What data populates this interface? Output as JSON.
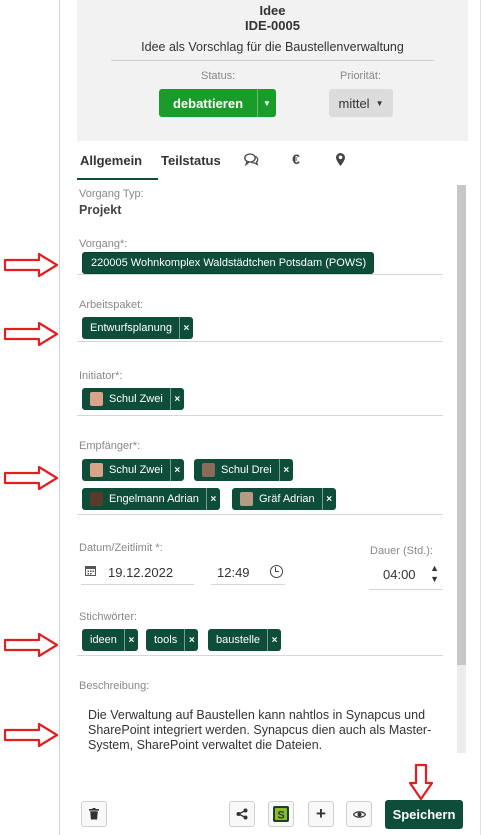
{
  "header": {
    "type": "Idee",
    "id": "IDE-0005",
    "title": "Idee als Vorschlag für die Baustellenverwaltung",
    "status_label": "Status:",
    "status_value": "debattieren",
    "priority_label": "Priorität:",
    "priority_value": "mittel",
    "status_color": "#1a9c2a"
  },
  "tabs": {
    "general": "Allgemein",
    "substatus": "Teilstatus",
    "icons": [
      "comments-icon",
      "euro-icon",
      "map-marker-icon"
    ],
    "euro_glyph": "€"
  },
  "form": {
    "vorgang_typ_label": "Vorgang Typ:",
    "vorgang_typ_value": "Projekt",
    "vorgang_label": "Vorgang*:",
    "vorgang_value": "220005 Wohnkomplex Waldstädtchen Potsdam (POWS)",
    "arbeitspaket_label": "Arbeitspaket:",
    "arbeitspaket_tags": [
      "Entwurfsplanung"
    ],
    "initiator_label": "Initiator*:",
    "initiator_tags": [
      "Schul Zwei"
    ],
    "empfaenger_label": "Empfänger*:",
    "empfaenger_tags": [
      "Schul Zwei",
      "Schul Drei",
      "Engelmann Adrian",
      "Gräf Adrian"
    ],
    "datum_label": "Datum/Zeitlimit *:",
    "datum_value": "19.12.2022",
    "zeit_value": "12:49",
    "dauer_label": "Dauer (Std.):",
    "dauer_value": "04:00",
    "stichwoerter_label": "Stichwörter:",
    "stichwoerter_tags": [
      "ideen",
      "tools",
      "baustelle"
    ],
    "beschreibung_label": "Beschreibung:",
    "beschreibung_value": "Die Verwaltung auf Baustellen kann nahtlos in Synapcus und SharePoint integriert werden. Synapcus dien auch als Master-System, SharePoint verwaltet die Dateien.",
    "remove_glyph": "×"
  },
  "footer": {
    "save_label": "Speichern",
    "plus_glyph": "+",
    "accent_color": "#0e4d3a"
  }
}
